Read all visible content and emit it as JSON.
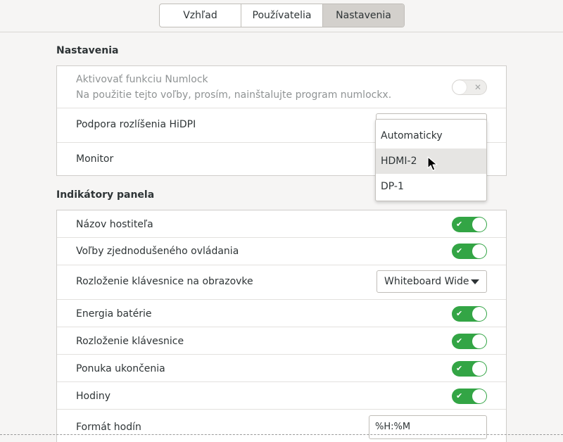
{
  "tabs": [
    {
      "label": "Vzhľad",
      "active": false
    },
    {
      "label": "Používatelia",
      "active": false
    },
    {
      "label": "Nastavenia",
      "active": true
    }
  ],
  "settings": {
    "title": "Nastavenia",
    "numlock": {
      "label": "Aktivovať funkciu Numlock",
      "description": "Na použitie tejto voľby, prosím, nainštalujte program numlockx.",
      "enabled": false,
      "disabled": true
    },
    "hidpi": {
      "label": "Podpora rozlíšenia HiDPI"
    },
    "monitor": {
      "label": "Monitor"
    }
  },
  "monitor_dropdown": {
    "options": [
      "Automaticky",
      "HDMI-2",
      "DP-1"
    ],
    "hovered": "HDMI-2"
  },
  "indicators": {
    "title": "Indikátory panela",
    "hostname": {
      "label": "Názov hostiteľa",
      "enabled": true
    },
    "a11y": {
      "label": "Voľby zjednodušeného ovládania",
      "enabled": true
    },
    "onscreen_keyboard": {
      "label": "Rozloženie klávesnice na obrazovke",
      "value": "Whiteboard Wide"
    },
    "battery": {
      "label": "Energia batérie",
      "enabled": true
    },
    "keyboard_layout": {
      "label": "Rozloženie klávesnice",
      "enabled": true
    },
    "power_menu": {
      "label": "Ponuka ukončenia",
      "enabled": true
    },
    "clock": {
      "label": "Hodiny",
      "enabled": true
    },
    "clock_format": {
      "label": "Formát hodín",
      "value": "%H:%M"
    }
  },
  "icons": {
    "switch_on": "checkmark-icon",
    "switch_off": "x-icon",
    "combo": "caret-down-icon",
    "cursor": "mouse-pointer-icon"
  },
  "colors": {
    "switch_on": "#33a545",
    "active_tab": "#d3d0cc",
    "hover_option": "#e6e5e3"
  }
}
